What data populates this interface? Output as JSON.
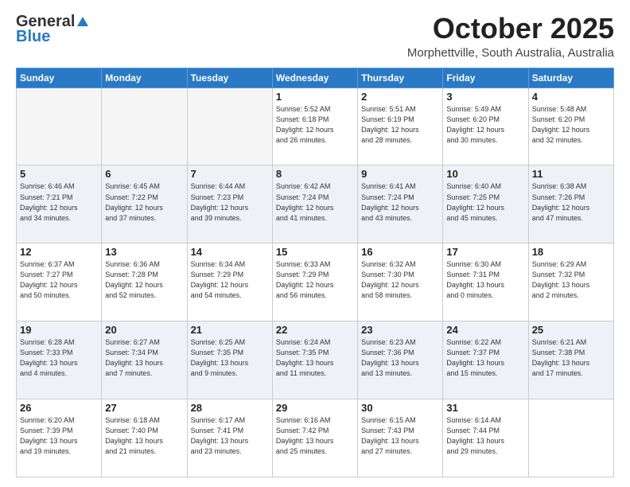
{
  "header": {
    "logo_general": "General",
    "logo_blue": "Blue",
    "month": "October 2025",
    "location": "Morphettville, South Australia, Australia"
  },
  "days_of_week": [
    "Sunday",
    "Monday",
    "Tuesday",
    "Wednesday",
    "Thursday",
    "Friday",
    "Saturday"
  ],
  "weeks": [
    [
      {
        "day": "",
        "info": ""
      },
      {
        "day": "",
        "info": ""
      },
      {
        "day": "",
        "info": ""
      },
      {
        "day": "1",
        "info": "Sunrise: 5:52 AM\nSunset: 6:18 PM\nDaylight: 12 hours\nand 26 minutes."
      },
      {
        "day": "2",
        "info": "Sunrise: 5:51 AM\nSunset: 6:19 PM\nDaylight: 12 hours\nand 28 minutes."
      },
      {
        "day": "3",
        "info": "Sunrise: 5:49 AM\nSunset: 6:20 PM\nDaylight: 12 hours\nand 30 minutes."
      },
      {
        "day": "4",
        "info": "Sunrise: 5:48 AM\nSunset: 6:20 PM\nDaylight: 12 hours\nand 32 minutes."
      }
    ],
    [
      {
        "day": "5",
        "info": "Sunrise: 6:46 AM\nSunset: 7:21 PM\nDaylight: 12 hours\nand 34 minutes."
      },
      {
        "day": "6",
        "info": "Sunrise: 6:45 AM\nSunset: 7:22 PM\nDaylight: 12 hours\nand 37 minutes."
      },
      {
        "day": "7",
        "info": "Sunrise: 6:44 AM\nSunset: 7:23 PM\nDaylight: 12 hours\nand 39 minutes."
      },
      {
        "day": "8",
        "info": "Sunrise: 6:42 AM\nSunset: 7:24 PM\nDaylight: 12 hours\nand 41 minutes."
      },
      {
        "day": "9",
        "info": "Sunrise: 6:41 AM\nSunset: 7:24 PM\nDaylight: 12 hours\nand 43 minutes."
      },
      {
        "day": "10",
        "info": "Sunrise: 6:40 AM\nSunset: 7:25 PM\nDaylight: 12 hours\nand 45 minutes."
      },
      {
        "day": "11",
        "info": "Sunrise: 6:38 AM\nSunset: 7:26 PM\nDaylight: 12 hours\nand 47 minutes."
      }
    ],
    [
      {
        "day": "12",
        "info": "Sunrise: 6:37 AM\nSunset: 7:27 PM\nDaylight: 12 hours\nand 50 minutes."
      },
      {
        "day": "13",
        "info": "Sunrise: 6:36 AM\nSunset: 7:28 PM\nDaylight: 12 hours\nand 52 minutes."
      },
      {
        "day": "14",
        "info": "Sunrise: 6:34 AM\nSunset: 7:29 PM\nDaylight: 12 hours\nand 54 minutes."
      },
      {
        "day": "15",
        "info": "Sunrise: 6:33 AM\nSunset: 7:29 PM\nDaylight: 12 hours\nand 56 minutes."
      },
      {
        "day": "16",
        "info": "Sunrise: 6:32 AM\nSunset: 7:30 PM\nDaylight: 12 hours\nand 58 minutes."
      },
      {
        "day": "17",
        "info": "Sunrise: 6:30 AM\nSunset: 7:31 PM\nDaylight: 13 hours\nand 0 minutes."
      },
      {
        "day": "18",
        "info": "Sunrise: 6:29 AM\nSunset: 7:32 PM\nDaylight: 13 hours\nand 2 minutes."
      }
    ],
    [
      {
        "day": "19",
        "info": "Sunrise: 6:28 AM\nSunset: 7:33 PM\nDaylight: 13 hours\nand 4 minutes."
      },
      {
        "day": "20",
        "info": "Sunrise: 6:27 AM\nSunset: 7:34 PM\nDaylight: 13 hours\nand 7 minutes."
      },
      {
        "day": "21",
        "info": "Sunrise: 6:25 AM\nSunset: 7:35 PM\nDaylight: 13 hours\nand 9 minutes."
      },
      {
        "day": "22",
        "info": "Sunrise: 6:24 AM\nSunset: 7:35 PM\nDaylight: 13 hours\nand 11 minutes."
      },
      {
        "day": "23",
        "info": "Sunrise: 6:23 AM\nSunset: 7:36 PM\nDaylight: 13 hours\nand 13 minutes."
      },
      {
        "day": "24",
        "info": "Sunrise: 6:22 AM\nSunset: 7:37 PM\nDaylight: 13 hours\nand 15 minutes."
      },
      {
        "day": "25",
        "info": "Sunrise: 6:21 AM\nSunset: 7:38 PM\nDaylight: 13 hours\nand 17 minutes."
      }
    ],
    [
      {
        "day": "26",
        "info": "Sunrise: 6:20 AM\nSunset: 7:39 PM\nDaylight: 13 hours\nand 19 minutes."
      },
      {
        "day": "27",
        "info": "Sunrise: 6:18 AM\nSunset: 7:40 PM\nDaylight: 13 hours\nand 21 minutes."
      },
      {
        "day": "28",
        "info": "Sunrise: 6:17 AM\nSunset: 7:41 PM\nDaylight: 13 hours\nand 23 minutes."
      },
      {
        "day": "29",
        "info": "Sunrise: 6:16 AM\nSunset: 7:42 PM\nDaylight: 13 hours\nand 25 minutes."
      },
      {
        "day": "30",
        "info": "Sunrise: 6:15 AM\nSunset: 7:43 PM\nDaylight: 13 hours\nand 27 minutes."
      },
      {
        "day": "31",
        "info": "Sunrise: 6:14 AM\nSunset: 7:44 PM\nDaylight: 13 hours\nand 29 minutes."
      },
      {
        "day": "",
        "info": ""
      }
    ]
  ]
}
